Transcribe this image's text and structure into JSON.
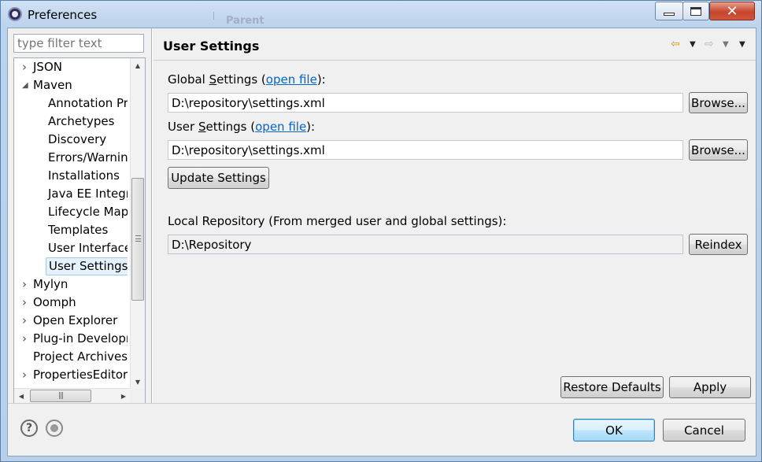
{
  "window": {
    "title": "Preferences",
    "background_title": "Parent"
  },
  "sidebar": {
    "filter_placeholder": "type filter text",
    "tree": [
      {
        "label": "JSON",
        "level": 0,
        "expander": "collapsed"
      },
      {
        "label": "Maven",
        "level": 0,
        "expander": "expanded"
      },
      {
        "label": "Annotation Pr",
        "level": 1
      },
      {
        "label": "Archetypes",
        "level": 1
      },
      {
        "label": "Discovery",
        "level": 1
      },
      {
        "label": "Errors/Warnin",
        "level": 1
      },
      {
        "label": "Installations",
        "level": 1
      },
      {
        "label": "Java EE Integra",
        "level": 1
      },
      {
        "label": "Lifecycle Mapp",
        "level": 1
      },
      {
        "label": "Templates",
        "level": 1
      },
      {
        "label": "User Interface",
        "level": 1
      },
      {
        "label": "User Settings",
        "level": 1,
        "selected": true
      },
      {
        "label": "Mylyn",
        "level": 0,
        "expander": "collapsed"
      },
      {
        "label": "Oomph",
        "level": 0,
        "expander": "collapsed"
      },
      {
        "label": "Open Explorer",
        "level": 0,
        "expander": "collapsed"
      },
      {
        "label": "Plug-in Developn",
        "level": 0,
        "expander": "collapsed"
      },
      {
        "label": "Project Archives",
        "level": 0
      },
      {
        "label": "PropertiesEditor",
        "level": 0,
        "expander": "collapsed"
      }
    ]
  },
  "page": {
    "title": "User Settings",
    "global_settings": {
      "label_before": "Global ",
      "label_mnemonic": "S",
      "label_after": "ettings (",
      "link": "open file",
      "label_end": "):",
      "value": "D:\\repository\\settings.xml",
      "browse_label": "Browse..."
    },
    "user_settings": {
      "label_before": "User ",
      "label_mnemonic": "S",
      "label_after": "ettings (",
      "link": "open file",
      "label_end": "):",
      "value": "D:\\repository\\settings.xml",
      "browse_label": "Browse..."
    },
    "update_button": "Update Settings",
    "local_repo": {
      "label": "Local Repository (From merged user and global settings):",
      "value": "D:\\Repository",
      "reindex_label": "Reindex"
    },
    "restore_defaults": "Restore Defaults",
    "apply": "Apply"
  },
  "footer": {
    "ok": "OK",
    "cancel": "Cancel",
    "help_glyph": "?"
  },
  "icons": {
    "nav_back": "arrow-left-icon",
    "nav_forward": "arrow-right-icon",
    "dropdown": "chevron-down-icon",
    "help": "help-icon",
    "record": "record-macro-icon"
  },
  "colors": {
    "link": "#0066cc",
    "selection_bg": "#e5f1fb",
    "close_button": "#c7452d"
  }
}
